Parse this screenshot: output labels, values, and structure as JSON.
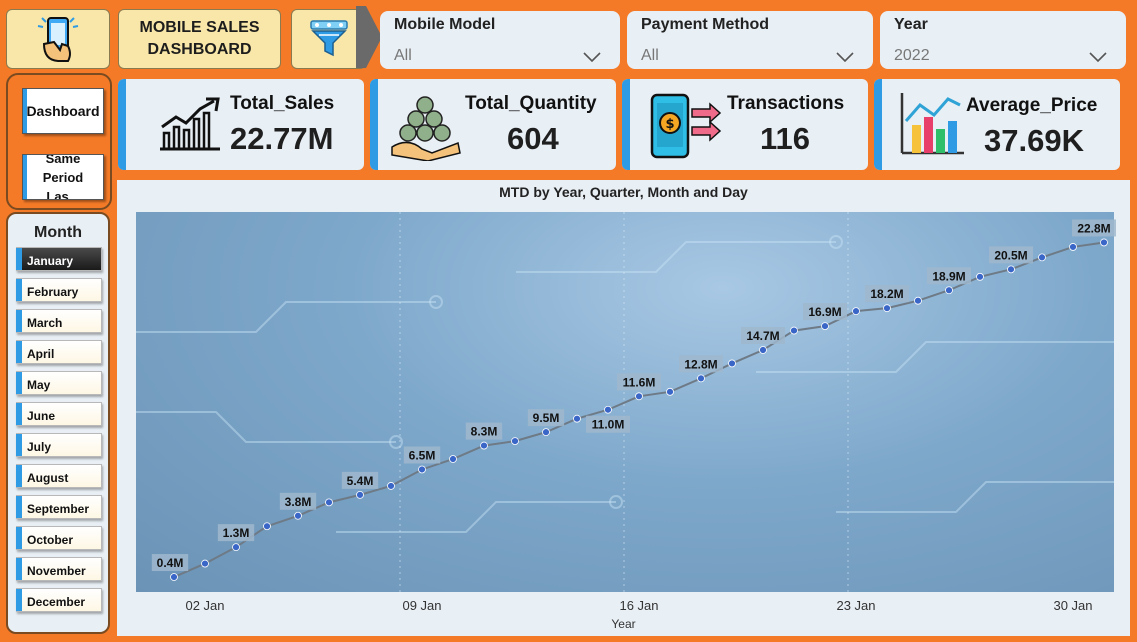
{
  "header": {
    "title": "MOBILE SALES DASHBOARD",
    "slicers": [
      {
        "label": "Mobile Model",
        "value": "All"
      },
      {
        "label": "Payment Method",
        "value": "All"
      },
      {
        "label": "Year",
        "value": "2022"
      }
    ]
  },
  "nav": {
    "dashboard_label": "Dashboard",
    "same_period_label": "Same Period Las..."
  },
  "month_filter": {
    "title": "Month",
    "items": [
      "January",
      "February",
      "March",
      "April",
      "May",
      "June",
      "July",
      "August",
      "September",
      "October",
      "November",
      "December"
    ],
    "selected": "January"
  },
  "kpis": [
    {
      "label": "Total_Sales",
      "value": "22.77M",
      "icon": "sales-growth-icon"
    },
    {
      "label": "Total_Quantity",
      "value": "604",
      "icon": "money-bags-icon"
    },
    {
      "label": "Transactions",
      "value": "116",
      "icon": "mobile-payment-icon"
    },
    {
      "label": "Average_Price",
      "value": "37.69K",
      "icon": "bar-chart-icon"
    }
  ],
  "colors": {
    "background": "#f47a27",
    "panel": "#e8eff5",
    "accent": "#2f9be4",
    "tile": "#f9e7a9",
    "line": "#6e7a86",
    "marker": "#3a66c8"
  },
  "chart_data": {
    "type": "line",
    "title": "MTD by Year, Quarter, Month and Day",
    "xlabel": "Year",
    "ylabel": "",
    "x_ticks": [
      "02 Jan",
      "09 Jan",
      "16 Jan",
      "23 Jan",
      "30 Jan"
    ],
    "x": [
      1,
      2,
      3,
      4,
      5,
      6,
      7,
      8,
      9,
      10,
      11,
      12,
      13,
      14,
      15,
      16,
      17,
      18,
      19,
      20,
      21,
      22,
      23,
      24,
      25,
      26,
      27,
      28,
      29,
      30,
      31
    ],
    "values": [
      0.4,
      1.3,
      2.4,
      3.8,
      4.5,
      5.4,
      5.9,
      6.5,
      7.6,
      8.3,
      9.2,
      9.5,
      10.1,
      11.0,
      11.6,
      12.5,
      12.8,
      13.7,
      14.7,
      15.6,
      16.9,
      17.2,
      18.2,
      18.4,
      18.9,
      19.6,
      20.5,
      21.0,
      21.8,
      22.5,
      22.8
    ],
    "data_labels": {
      "1": "0.4M",
      "3": "1.3M",
      "5": "3.8M",
      "7": "5.4M",
      "9": "6.5M",
      "11": "8.3M",
      "13": "9.5M",
      "15": "11.0M",
      "16": "11.6M",
      "18": "12.8M",
      "20": "14.7M",
      "22": "16.9M",
      "24": "18.2M",
      "26": "18.9M",
      "28": "20.5M",
      "31": "22.8M"
    },
    "ylim": [
      0,
      23.5
    ],
    "grid": false
  }
}
